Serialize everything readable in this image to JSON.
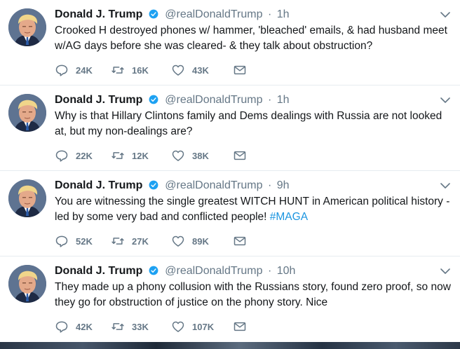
{
  "colors": {
    "text": "#14171a",
    "secondary": "#657786",
    "link": "#1b95e0",
    "verified": "#1da1f2",
    "divider": "#e6ecf0"
  },
  "icons": {
    "reply": "reply-icon",
    "retweet": "retweet-icon",
    "like": "heart-icon",
    "dm": "envelope-icon",
    "menu": "chevron-down-icon",
    "verified": "verified-badge-icon"
  },
  "tweets": [
    {
      "name": "Donald J. Trump",
      "handle": "@realDonaldTrump",
      "separator": "·",
      "time": "1h",
      "text": "Crooked H destroyed phones w/ hammer, 'bleached' emails, & had husband meet w/AG days before she was cleared- & they talk about obstruction?",
      "hashtag": "",
      "replies": "24K",
      "retweets": "16K",
      "likes": "43K"
    },
    {
      "name": "Donald J. Trump",
      "handle": "@realDonaldTrump",
      "separator": "·",
      "time": "1h",
      "text": "Why is that Hillary Clintons family and Dems dealings with Russia are not looked at, but my non-dealings are?",
      "hashtag": "",
      "replies": "22K",
      "retweets": "12K",
      "likes": "38K"
    },
    {
      "name": "Donald J. Trump",
      "handle": "@realDonaldTrump",
      "separator": "·",
      "time": "9h",
      "text": "You are witnessing the single greatest WITCH HUNT in American political history - led by some very bad and conflicted people!",
      "hashtag": "#MAGA",
      "replies": "52K",
      "retweets": "27K",
      "likes": "89K"
    },
    {
      "name": "Donald J. Trump",
      "handle": "@realDonaldTrump",
      "separator": "·",
      "time": "10h",
      "text": "They made up a phony collusion with the Russians story, found zero proof, so now they go for obstruction of justice on the phony story. Nice",
      "hashtag": "",
      "replies": "42K",
      "retweets": "33K",
      "likes": "107K"
    }
  ]
}
